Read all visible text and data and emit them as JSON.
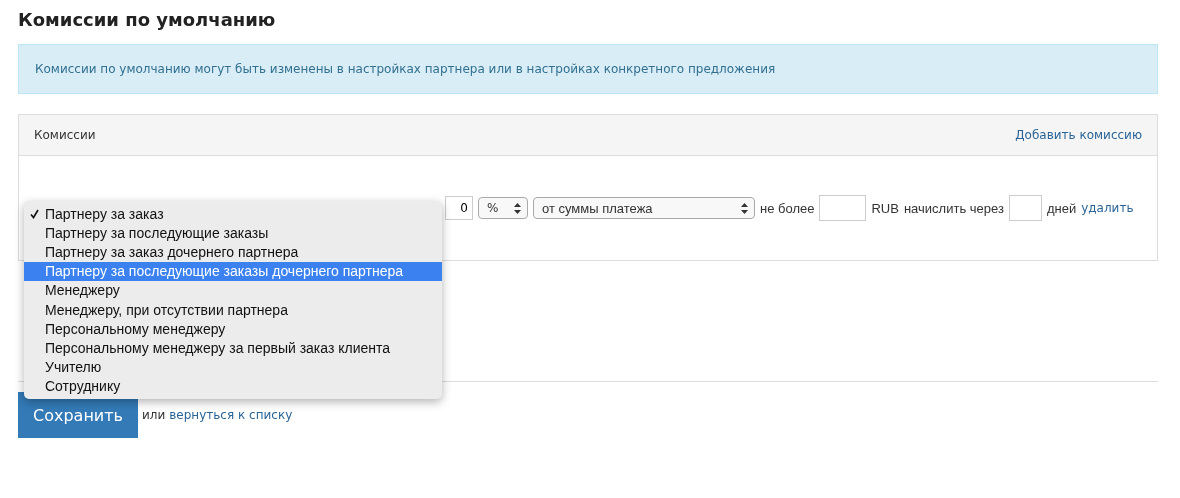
{
  "page_title": "Комиссии по умолчанию",
  "info_message": "Комиссии по умолчанию могут быть изменены в настройках партнера или в настройках конкретного предложения",
  "panel": {
    "title": "Комиссии",
    "add_link": "Добавить комиссию",
    "row": {
      "amount": "0",
      "unit": "%",
      "basis": "от суммы платежа",
      "max_label": "не более",
      "currency": "RUB",
      "delay_label": "начислить через",
      "days_label": "дней",
      "delete_link": "удалить"
    }
  },
  "type_menu": [
    {
      "label": "Партнеру за заказ",
      "checked": true,
      "highlighted": false
    },
    {
      "label": "Партнеру за последующие заказы",
      "checked": false,
      "highlighted": false
    },
    {
      "label": "Партнеру за заказ дочернего партнера",
      "checked": false,
      "highlighted": false
    },
    {
      "label": "Партнеру за последующие заказы дочернего партнера",
      "checked": false,
      "highlighted": true
    },
    {
      "label": "Менеджеру",
      "checked": false,
      "highlighted": false
    },
    {
      "label": "Менеджеру, при отсутствии партнера",
      "checked": false,
      "highlighted": false
    },
    {
      "label": "Персональному менеджеру",
      "checked": false,
      "highlighted": false
    },
    {
      "label": "Персональному менеджеру за первый заказ клиента",
      "checked": false,
      "highlighted": false
    },
    {
      "label": "Учителю",
      "checked": false,
      "highlighted": false
    },
    {
      "label": "Сотруднику",
      "checked": false,
      "highlighted": false
    }
  ],
  "save_button": "Сохранить",
  "or_text": "или",
  "back_link": "вернуться к списку"
}
